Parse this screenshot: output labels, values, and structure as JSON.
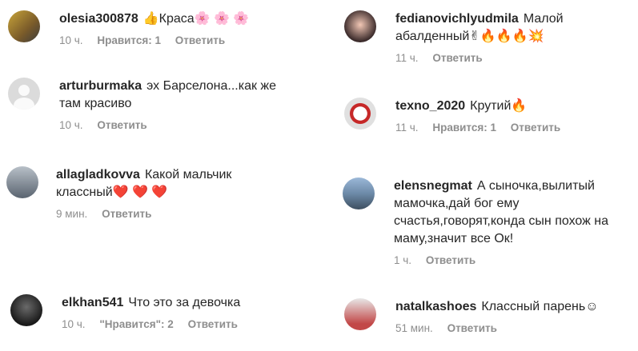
{
  "colors": {
    "text": "#262626",
    "meta": "#8e8e8e",
    "heart": "#e0245e",
    "fire": "#ff6a00"
  },
  "comments_left": [
    {
      "user": "olesia300878",
      "text": "👍Краса🌸 🌸 🌸",
      "time": "10 ч.",
      "likes": "Нравится: 1",
      "reply": "Ответить",
      "avatar": "avatar-olesia-icon"
    },
    {
      "user": "arturburmaka",
      "text": "эх Барселона...как же там красиво",
      "time": "10 ч.",
      "likes": "",
      "reply": "Ответить",
      "avatar": "default-avatar-icon"
    },
    {
      "user": "allagladkovva",
      "text": "Какой мальчик классный❤️ ❤️ ❤️",
      "time": "9 мин.",
      "likes": "",
      "reply": "Ответить",
      "avatar": "avatar-alla-icon"
    },
    {
      "user": "elkhan541",
      "text": "Что это за девочка",
      "time": "10 ч.",
      "likes": "\"Нравится\": 2",
      "reply": "Ответить",
      "avatar": "avatar-elkhan-icon"
    }
  ],
  "comments_right": [
    {
      "user": "fedianovichlyudmila",
      "text": "Малой абалденный✌🔥🔥🔥💥",
      "time": "11 ч.",
      "likes": "",
      "reply": "Ответить",
      "avatar": "avatar-fedianovich-icon"
    },
    {
      "user": "texno_2020",
      "text": "Крутий🔥",
      "time": "11 ч.",
      "likes": "Нравится: 1",
      "reply": "Ответить",
      "avatar": "avatar-texno-icon"
    },
    {
      "user": "elensnegmat",
      "text": "А сыночка,вылитый мамочка,дай бог ему счастья,говорят,конда сын похож на маму,значит все Ок!",
      "time": "1 ч.",
      "likes": "",
      "reply": "Ответить",
      "avatar": "avatar-elens-icon"
    },
    {
      "user": "natalkashoes",
      "text": "Классный парень☺",
      "time": "51 мин.",
      "likes": "",
      "reply": "Ответить",
      "avatar": "avatar-natalka-icon"
    }
  ]
}
